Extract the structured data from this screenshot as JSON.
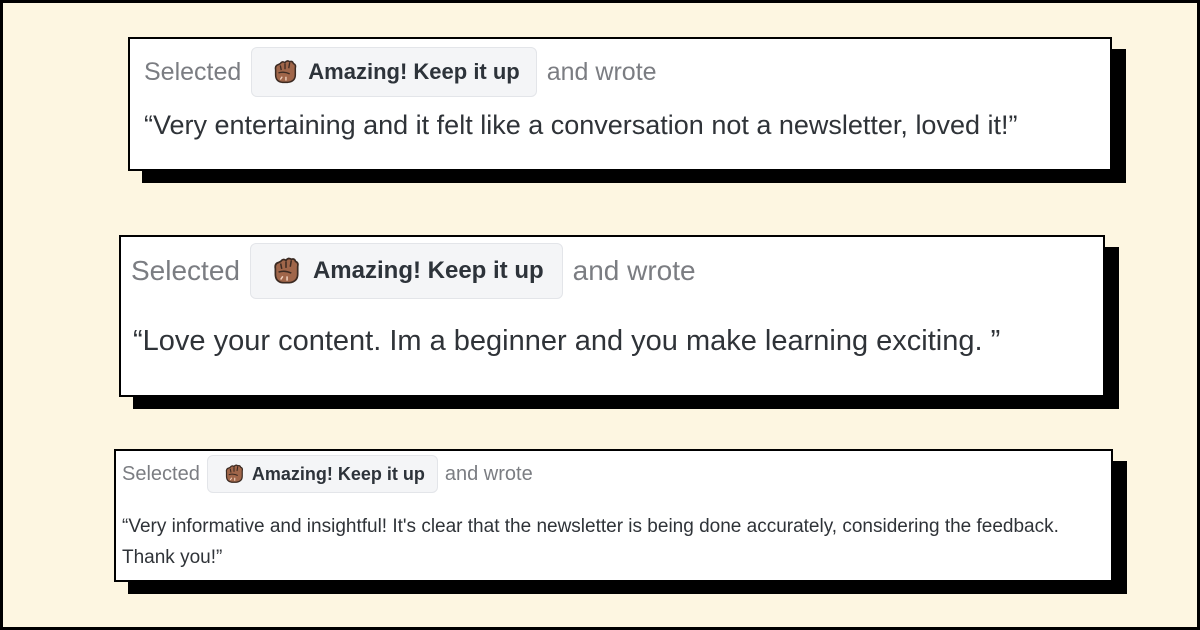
{
  "cards": [
    {
      "prefix": "Selected",
      "chip_label": "Amazing! Keep it up",
      "chip_icon": "fist-bump-icon",
      "suffix": "and wrote",
      "quote": "“Very entertaining and it felt like a conversation not a newsletter, loved it!”"
    },
    {
      "prefix": "Selected",
      "chip_label": "Amazing! Keep it up",
      "chip_icon": "fist-bump-icon",
      "suffix": "and wrote",
      "quote": "“Love your content. Im a beginner and you make learning exciting. ”"
    },
    {
      "prefix": "Selected",
      "chip_label": "Amazing! Keep it up",
      "chip_icon": "fist-bump-icon",
      "suffix": "and wrote",
      "quote": "“Very informative and insightful! It's clear that the newsletter is being done accurately, considering the feedback. Thank you!”"
    }
  ],
  "colors": {
    "background": "#fdf6e1",
    "card": "#ffffff",
    "border": "#000000",
    "chip_bg": "#f4f5f7",
    "muted_text": "#7b7d82",
    "quote_text": "#2f3338",
    "icon_fill": "#a0664a"
  }
}
